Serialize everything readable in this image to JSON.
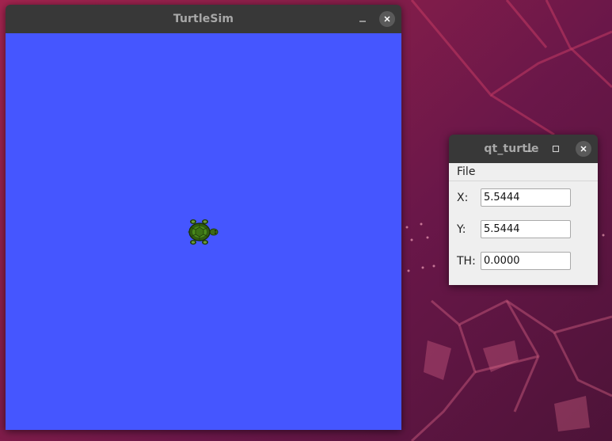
{
  "colors": {
    "canvas_background": "#4556ff",
    "titlebar": "#383838",
    "title_text": "#a8a8a8",
    "qt_panel": "#efefef"
  },
  "turtlesim_window": {
    "title": "TurtleSim",
    "minimize_icon": "minimize-icon",
    "close_icon": "close-icon",
    "turtle_icon": "turtle-icon"
  },
  "qt_turtle_window": {
    "title": "qt_turtle",
    "minimize_icon": "minimize-icon",
    "maximize_icon": "maximize-icon",
    "close_icon": "close-icon",
    "menu": {
      "file_label": "File"
    },
    "fields": [
      {
        "label": "X:",
        "value": "5.5444"
      },
      {
        "label": "Y:",
        "value": "5.5444"
      },
      {
        "label": "TH:",
        "value": "0.0000"
      }
    ]
  }
}
